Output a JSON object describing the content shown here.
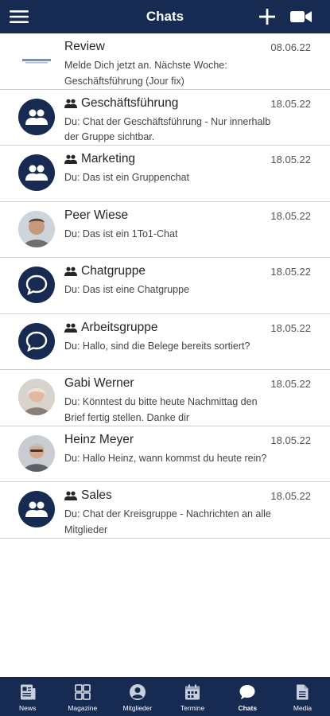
{
  "header": {
    "title": "Chats",
    "background": "#162a52",
    "icons": [
      "hamburger-menu-icon",
      "plus-icon",
      "video-camera-icon"
    ]
  },
  "chats": [
    {
      "name": "Review",
      "date": "08.06.22",
      "preview": "Melde Dich jetzt an. Nächste Woche: Geschäftsführung (Jour fix)",
      "type": "logo",
      "is_group": false
    },
    {
      "name": "Geschäftsführung",
      "date": "18.05.22",
      "preview": "Du: Chat der Geschäftsführung - Nur innerhalb der Gruppe sichtbar.",
      "type": "group",
      "is_group": true
    },
    {
      "name": "Marketing",
      "date": "18.05.22",
      "preview": "Du: Das ist ein Gruppenchat",
      "type": "group",
      "is_group": true
    },
    {
      "name": "Peer Wiese",
      "date": "18.05.22",
      "preview": "Du: Das ist ein 1To1-Chat",
      "type": "photo",
      "is_group": false
    },
    {
      "name": "Chatgruppe",
      "date": "18.05.22",
      "preview": "Du: Das ist eine Chatgruppe",
      "type": "chat-bubble",
      "is_group": true
    },
    {
      "name": "Arbeitsgruppe",
      "date": "18.05.22",
      "preview": "Du: Hallo, sind die Belege bereits sortiert?",
      "type": "chat-bubble",
      "is_group": true
    },
    {
      "name": "Gabi Werner",
      "date": "18.05.22",
      "preview": "Du: Könntest du bitte heute Nachmittag den Brief fertig stellen. Danke dir",
      "type": "photo",
      "is_group": false
    },
    {
      "name": "Heinz Meyer",
      "date": "18.05.22",
      "preview": "Du: Hallo Heinz, wann kommst du heute rein?",
      "type": "photo",
      "is_group": false
    },
    {
      "name": "Sales",
      "date": "18.05.22",
      "preview": "Du: Chat der Kreisgruppe - Nachrichten an alle Mitglieder",
      "type": "group",
      "is_group": true
    }
  ],
  "tabs": [
    {
      "label": "News",
      "icon": "news-icon"
    },
    {
      "label": "Magazine",
      "icon": "grid-icon"
    },
    {
      "label": "Mitglieder",
      "icon": "user-icon"
    },
    {
      "label": "Termine",
      "icon": "calendar-icon"
    },
    {
      "label": "Chats",
      "icon": "chat-icon",
      "active": true
    },
    {
      "label": "Media",
      "icon": "document-icon"
    }
  ]
}
